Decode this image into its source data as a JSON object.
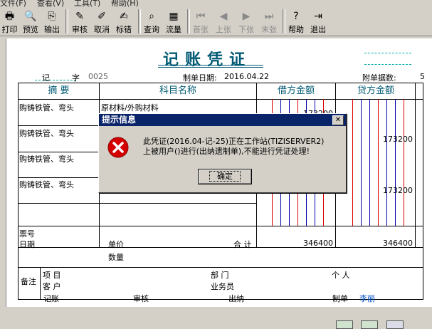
{
  "menu": [
    "文件(F)",
    "查看(V)",
    "工具(T)",
    "帮助(H)"
  ],
  "toolbar": {
    "print": "打印",
    "preview": "预览",
    "export": "输出",
    "audit": "审核",
    "cancel": "取消",
    "mark_error": "标错",
    "query": "查询",
    "cashflow": "流量",
    "first": "首张",
    "prev": "上张",
    "next": "下张",
    "last": "末张",
    "help": "帮助",
    "exit": "退出"
  },
  "voucher": {
    "title": "记账凭证",
    "word_label": "记",
    "word_char": "字",
    "number": "0025",
    "date_label": "制单日期:",
    "date": "2016.04.22",
    "attach_label": "附单据数:",
    "attach_count": "5",
    "col_summary": "摘  要",
    "col_account": "科目名称",
    "col_debit": "借方金额",
    "col_credit": "贷方金额",
    "rows": [
      {
        "summary": "购铸铁管、弯头",
        "account": "原材料/外购材料",
        "debit": "173200",
        "credit": ""
      },
      {
        "summary": "购铸铁管、弯头",
        "account": "",
        "debit": "",
        "credit": "173200"
      },
      {
        "summary": "购铸铁管、弯头",
        "account": "",
        "debit": "",
        "credit": ""
      },
      {
        "summary": "购铸铁管、弯头",
        "account": "",
        "debit": "",
        "credit": "173200"
      }
    ],
    "ticket_label": "票号",
    "date_row_label": "日期",
    "unit_price_label": "单价",
    "quantity_label": "数量",
    "total_label": "合 计",
    "total_debit": "346400",
    "total_credit": "346400",
    "remark_label": "备注",
    "project_label": "项  目",
    "customer_label": "客  户",
    "dept_label": "部  门",
    "clerk_label": "业务员",
    "person_label": "个  人",
    "footer": {
      "bookkeeping": "记账",
      "audit": "审核",
      "cashier": "出纳",
      "maker_label": "制单",
      "maker_name": "李丽"
    }
  },
  "dialog": {
    "title": "提示信息",
    "line1": "此凭证(2016.04-记-25)正在工作站(TIZISERVER2)",
    "line2": "上被用户()进行(出纳遗制单),不能进行凭证处理!",
    "ok": "确定",
    "close": "✕"
  },
  "colors": {
    "title_blue": "#005a73",
    "dialog_title_bg": "#0a246a",
    "error_red": "#d40000"
  }
}
